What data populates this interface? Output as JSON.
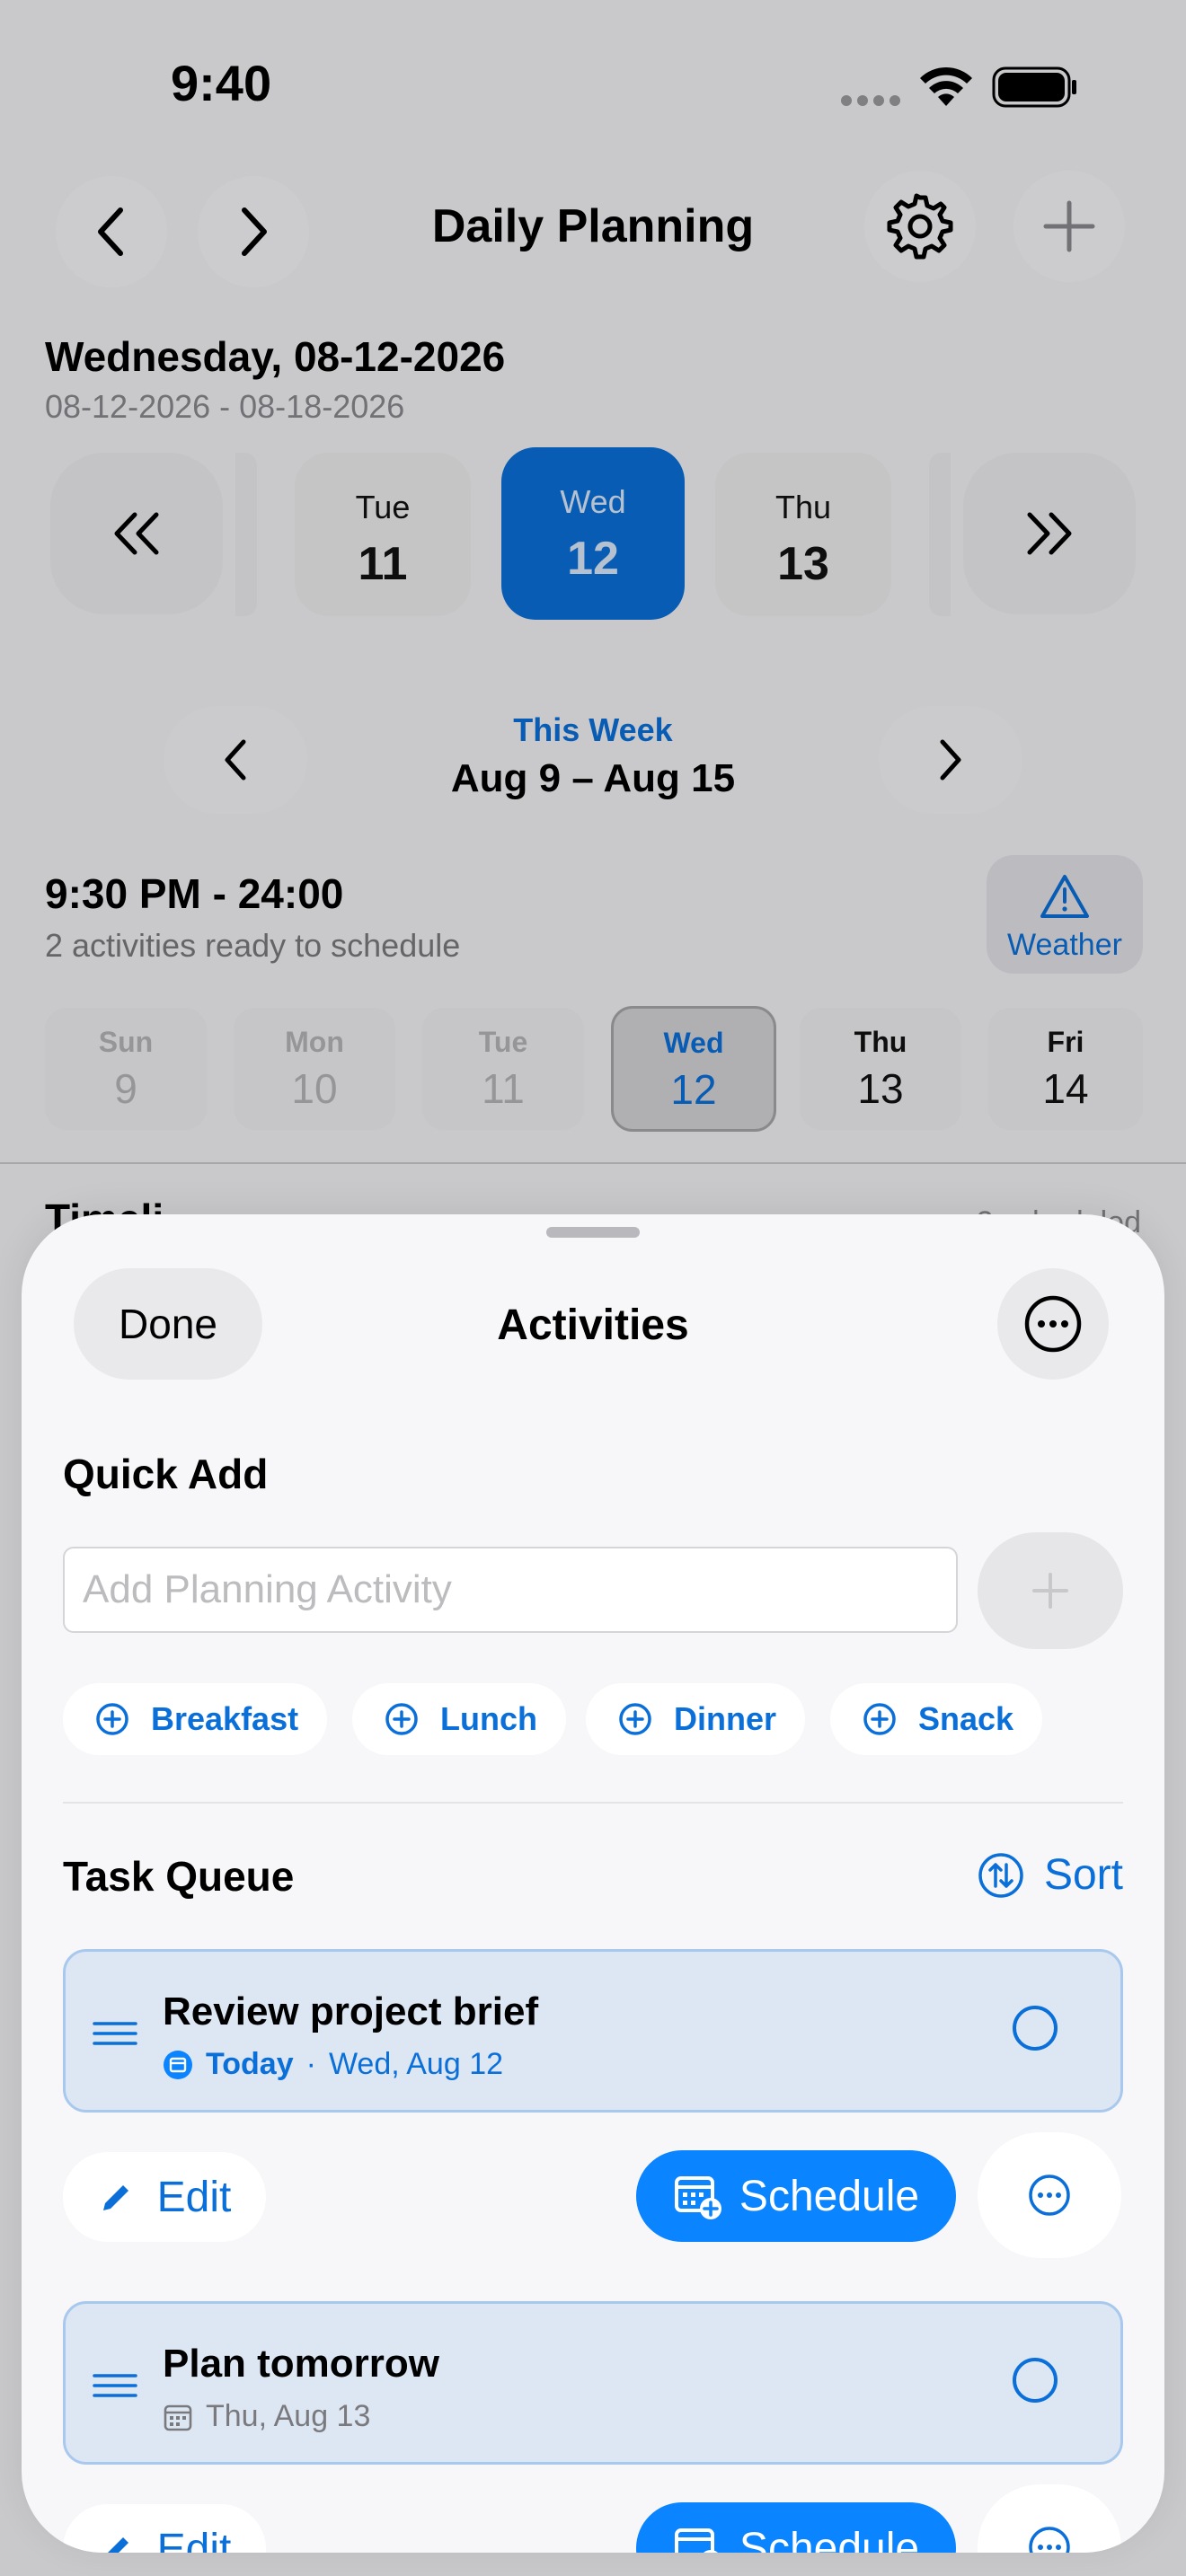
{
  "status_bar": {
    "time": "9:40"
  },
  "nav": {
    "title": "Daily Planning"
  },
  "date_header": {
    "title": "Wednesday, 08-12-2026",
    "range": "08-12-2026 - 08-18-2026"
  },
  "day_strip": [
    {
      "name": "Tue",
      "num": "11"
    },
    {
      "name": "Wed",
      "num": "12"
    },
    {
      "name": "Thu",
      "num": "13"
    }
  ],
  "week_nav": {
    "label": "This Week",
    "range": "Aug 9 – Aug 15"
  },
  "session": {
    "time_range": "9:30 PM - 24:00",
    "ready_text": "2 activities ready to schedule"
  },
  "weather": {
    "label": "Weather"
  },
  "week_days": [
    {
      "name": "Sun",
      "num": "9"
    },
    {
      "name": "Mon",
      "num": "10"
    },
    {
      "name": "Tue",
      "num": "11"
    },
    {
      "name": "Wed",
      "num": "12"
    },
    {
      "name": "Thu",
      "num": "13"
    },
    {
      "name": "Fri",
      "num": "14"
    }
  ],
  "timeline_peek": {
    "title": "Timeli",
    "count": "2 scheduled"
  },
  "sheet": {
    "done_label": "Done",
    "title": "Activities",
    "quick_add_title": "Quick Add",
    "input_placeholder": "Add Planning Activity",
    "chips": [
      "Breakfast",
      "Lunch",
      "Dinner",
      "Snack"
    ],
    "task_queue_title": "Task Queue",
    "sort_label": "Sort",
    "tasks": [
      {
        "name": "Review project brief",
        "today": "Today",
        "dot": "·",
        "date": "Wed, Aug 12"
      },
      {
        "name": "Plan tomorrow",
        "date": "Thu, Aug 13"
      }
    ],
    "edit_label": "Edit",
    "schedule_label": "Schedule"
  },
  "colors": {
    "accent": "#0a6fd8",
    "button_blue": "#0a84ff",
    "task_bg": "#dde7f4"
  }
}
